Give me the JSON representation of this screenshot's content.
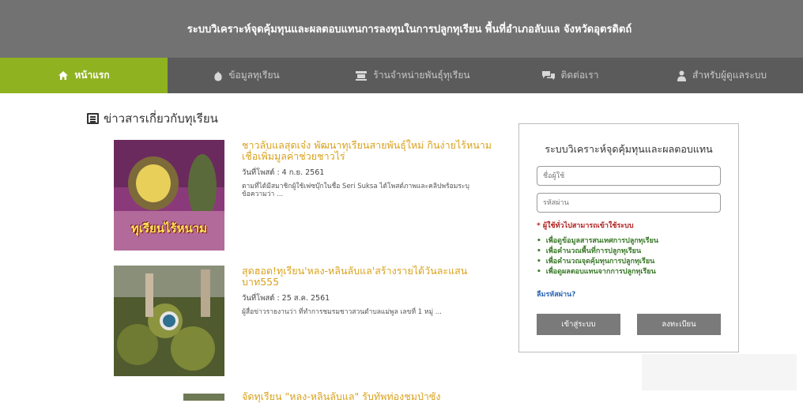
{
  "header": {
    "title": "ระบบวิเคราะห์จุดคุ้มทุนและผลตอบแทนการลงทุนในการปลูกทุเรียน พื้นที่อำเภอลับแล จังหวัดอุตรดิตถ์"
  },
  "nav": {
    "items": [
      {
        "label": "หน้าแรก",
        "icon": "home-icon"
      },
      {
        "label": "ข้อมูลทุเรียน",
        "icon": "durian-icon"
      },
      {
        "label": "ร้านจำหน่ายพันธุ์ทุเรียน",
        "icon": "shop-icon"
      },
      {
        "label": "ติดต่อเรา",
        "icon": "chat-icon"
      },
      {
        "label": "สำหรับผู้ดูแลระบบ",
        "icon": "admin-user-icon"
      }
    ]
  },
  "news": {
    "section_title": "ข่าวสารเกี่ยวกับทุเรียน",
    "items": [
      {
        "title": "ชาวลับแลสุดเจ๋ง พัฒนาทุเรียนสายพันธุ์ใหม่ กินง่ายไร้หนาม เชื่อเพิ่มมูลค่าช่วยชาวไร่",
        "date": "วันที่โพสต์ : 4 ก.ย. 2561",
        "desc": "ตามที่ได้มีสมาชิกผู้ใช้เฟซบุ๊กในชื่อ Seri Suksa ได้โพสต์ภาพและคลิปพร้อมระบุข้อความว่า ...",
        "thumb_text": "ทุเรียนไร้หนาม"
      },
      {
        "title": "สุดฮอต!ทุเรียน'หลง-หลินลับแล'สร้างรายได้วันละแสนบาท555",
        "date": "วันที่โพสต์ : 25 ส.ค. 2561",
        "desc": "ผู้สื่อข่าวรายงานว่า ที่ทำการชมรมชาวสวนตำบลแม่พูล เลขที่ 1 หมู่ ...",
        "thumb_text": ""
      },
      {
        "title": "จัดทุเรียน \"หลง-หลินลับแล\" รับทัพท่องชมป่าซัง",
        "date": "",
        "desc": "",
        "thumb_text": ""
      }
    ]
  },
  "login": {
    "title": "ระบบวิเคราะห์จุดคุ้มทุนและผลตอบแทน",
    "username_placeholder": "ชื่อผู้ใช้",
    "password_placeholder": "รหัสผ่าน",
    "notice": "* ผู้ใช้ทั่วไปสามารถเข้าใช้ระบบ",
    "features": [
      "เพื่อดูข้อมูลสารสนเทศการปลูกทุเรียน",
      "เพื่อคำนวณพื้นที่การปลูกทุเรียน",
      "เพื่อคำนวณจุดคุ้มทุนการปลูกทุเรียน",
      "เพื่อดูผลตอบแทนจากการปลูกทุเรียน"
    ],
    "forgot": "ลืมรหัสผ่าน?",
    "login_button": "เข้าสู่ระบบ",
    "register_button": "ลงทะเบียน"
  },
  "colors": {
    "header": "#727272",
    "nav": "#5b5b5b",
    "nav_active": "#8fb220",
    "news_title": "#d9a21e"
  }
}
